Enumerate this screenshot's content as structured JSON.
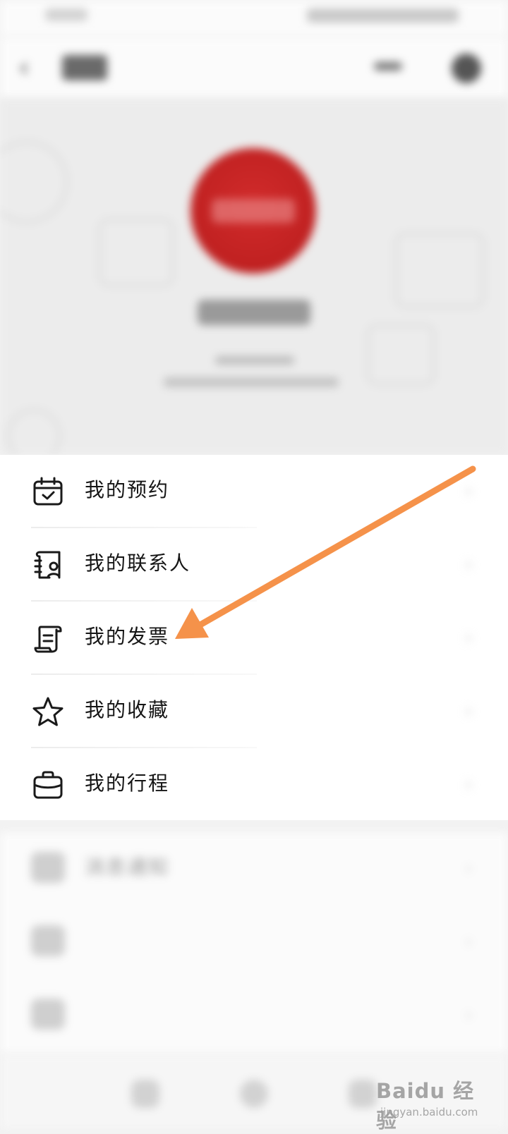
{
  "menu": {
    "items": [
      {
        "label": "我的预约",
        "icon": "calendar-check-icon"
      },
      {
        "label": "我的联系人",
        "icon": "contacts-icon"
      },
      {
        "label": "我的发票",
        "icon": "receipt-icon"
      },
      {
        "label": "我的收藏",
        "icon": "star-icon"
      },
      {
        "label": "我的行程",
        "icon": "briefcase-icon"
      }
    ],
    "chevron": "›"
  },
  "settings": {
    "items": [
      {
        "label": "消息通知",
        "icon": "message-icon"
      },
      {
        "label": "",
        "icon": "settings-icon"
      },
      {
        "label": "",
        "icon": "info-icon"
      }
    ]
  },
  "header": {
    "back_glyph": "‹"
  },
  "watermark": {
    "main": "Baidu 经验",
    "sub": "jingyan.baidu.com"
  },
  "colors": {
    "annotation_arrow": "#f5924a",
    "avatar_red": "#c72424"
  }
}
